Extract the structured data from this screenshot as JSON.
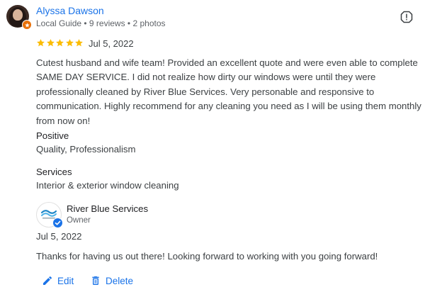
{
  "review": {
    "reviewer": {
      "name": "Alyssa Dawson",
      "meta": "Local Guide • 9 reviews • 2 photos",
      "avatar_icon": "user-avatar-photo",
      "badge_icon": "local-guide-badge-icon"
    },
    "rating": {
      "stars": 5,
      "max": 5,
      "color": "#fbbc04"
    },
    "date": "Jul 5, 2022",
    "text": "Cutest husband and wife team! Provided an excellent quote and were even able to complete SAME DAY SERVICE. I did not realize how dirty our windows were until they were professionally cleaned by River Blue Services. Very personable and responsive to communication. Highly recommend for any cleaning you need as I will be using them monthly from now on!",
    "positive": {
      "label": "Positive",
      "value": "Quality, Professionalism"
    },
    "services": {
      "label": "Services",
      "value": "Interior & exterior window cleaning"
    },
    "report_icon": "report-icon"
  },
  "owner_response": {
    "business_name": "River Blue Services",
    "role": "Owner",
    "logo_icon": "business-logo",
    "verified_icon": "verified-check-icon",
    "date": "Jul 5, 2022",
    "text": "Thanks for having us out there! Looking forward to working with you going forward!"
  },
  "actions": {
    "edit_label": "Edit",
    "delete_label": "Delete",
    "edit_icon": "pencil-icon",
    "delete_icon": "trash-icon"
  },
  "colors": {
    "link": "#1a73e8",
    "star": "#fbbc04",
    "guide_badge": "#e8710a",
    "body_text": "#3c4043",
    "meta_text": "#5f6368"
  }
}
